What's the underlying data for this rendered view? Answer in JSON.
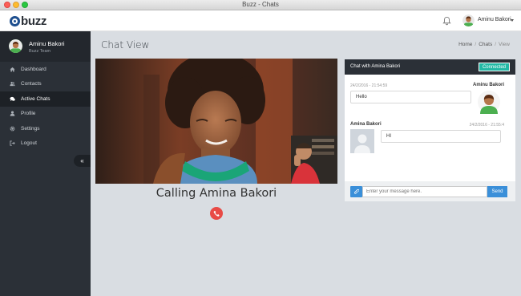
{
  "window": {
    "title": "Buzz - Chats"
  },
  "app": {
    "logo_text": "buzz"
  },
  "topnav": {
    "user_name": "Aminu Bakori"
  },
  "sidebar": {
    "user_name": "Aminu Bakori",
    "team": "Buzz Team",
    "items": [
      {
        "label": "Dashboard",
        "icon": "home-icon"
      },
      {
        "label": "Contacts",
        "icon": "users-icon"
      },
      {
        "label": "Active Chats",
        "icon": "chat-icon",
        "active": true
      },
      {
        "label": "Profile",
        "icon": "user-icon"
      },
      {
        "label": "Settings",
        "icon": "gear-icon"
      },
      {
        "label": "Logout",
        "icon": "logout-icon"
      }
    ],
    "collapse_glyph": "«"
  },
  "page": {
    "title": "Chat View",
    "breadcrumb": [
      "Home",
      "Chats",
      "View"
    ]
  },
  "call": {
    "text": "Calling Amina Bakori"
  },
  "chat": {
    "title": "Chat with Amina Bakori",
    "status": "Connected",
    "messages": [
      {
        "sender": "Aminu Bakori",
        "time": "24/2/2016 - 21:54:59",
        "text": "Hello"
      },
      {
        "sender": "Amina Bakori",
        "time": "24/2/2016 - 21:55:4",
        "text": "HI"
      }
    ],
    "input_placeholder": "Enter your message here.",
    "send_label": "Send"
  },
  "colors": {
    "sidebar_bg": "#2b3037",
    "accent_blue": "#3a8fd9",
    "connected_green": "#22b8a5",
    "hangup_red": "#e84a45"
  }
}
